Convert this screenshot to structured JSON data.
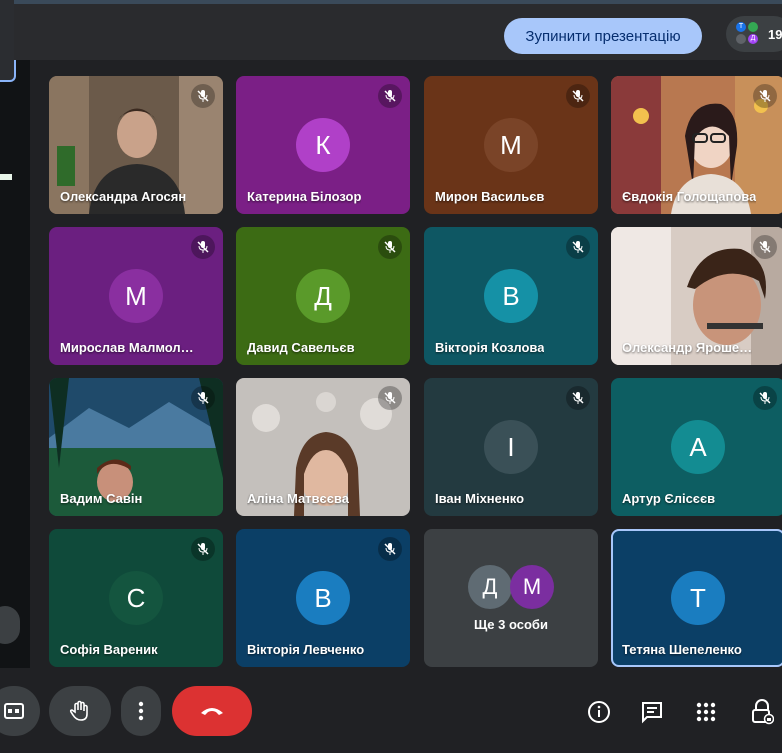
{
  "presentation": {
    "stop_label": "Зупинити презентацію"
  },
  "people": {
    "count": "19",
    "dot_letters": [
      "Т",
      "",
      "",
      "Д"
    ]
  },
  "tiles": [
    {
      "name": "Олександра Агосян",
      "type": "video"
    },
    {
      "name": "Катерина Білозор",
      "initial": "К",
      "bg": "#7b1f86",
      "avatar": "#b040c8"
    },
    {
      "name": "Мирон Васильєв",
      "initial": "М",
      "bg": "#6a3418",
      "avatar": "#7a4428"
    },
    {
      "name": "Євдокія Голощапова",
      "type": "video"
    },
    {
      "name": "Мирослав Малмол…",
      "initial": "М",
      "bg": "#6b1f80",
      "avatar": "#8a2fa0"
    },
    {
      "name": "Давид Савельєв",
      "initial": "Д",
      "bg": "#3c6b14",
      "avatar": "#5a9a2a"
    },
    {
      "name": "Вікторія Козлова",
      "initial": "В",
      "bg": "#0e5763",
      "avatar": "#1591a6"
    },
    {
      "name": "Олександр Ярошe…",
      "type": "video"
    },
    {
      "name": "Вадим Савін",
      "type": "video"
    },
    {
      "name": "Аліна Матвєєва",
      "type": "video"
    },
    {
      "name": "Іван Міхненко",
      "initial": "І",
      "bg": "#233a40",
      "avatar": "#3a5057"
    },
    {
      "name": "Артур Єлісєєв",
      "initial": "А",
      "bg": "#0d5e62",
      "avatar": "#138c92"
    },
    {
      "name": "Софія Вареник",
      "initial": "С",
      "bg": "#0f4a3a",
      "avatar": "#14553f"
    },
    {
      "name": "Вікторія Левченко",
      "initial": "В",
      "bg": "#0b3f66",
      "avatar": "#1a7dc0"
    },
    {
      "name": "Ще 3 особи",
      "type": "more",
      "initials": [
        "Д",
        "М"
      ]
    },
    {
      "name": "Тетяна Шепеленко",
      "initial": "Т",
      "bg": "#0b3f66",
      "avatar": "#1a7dc0",
      "active": true
    }
  ]
}
